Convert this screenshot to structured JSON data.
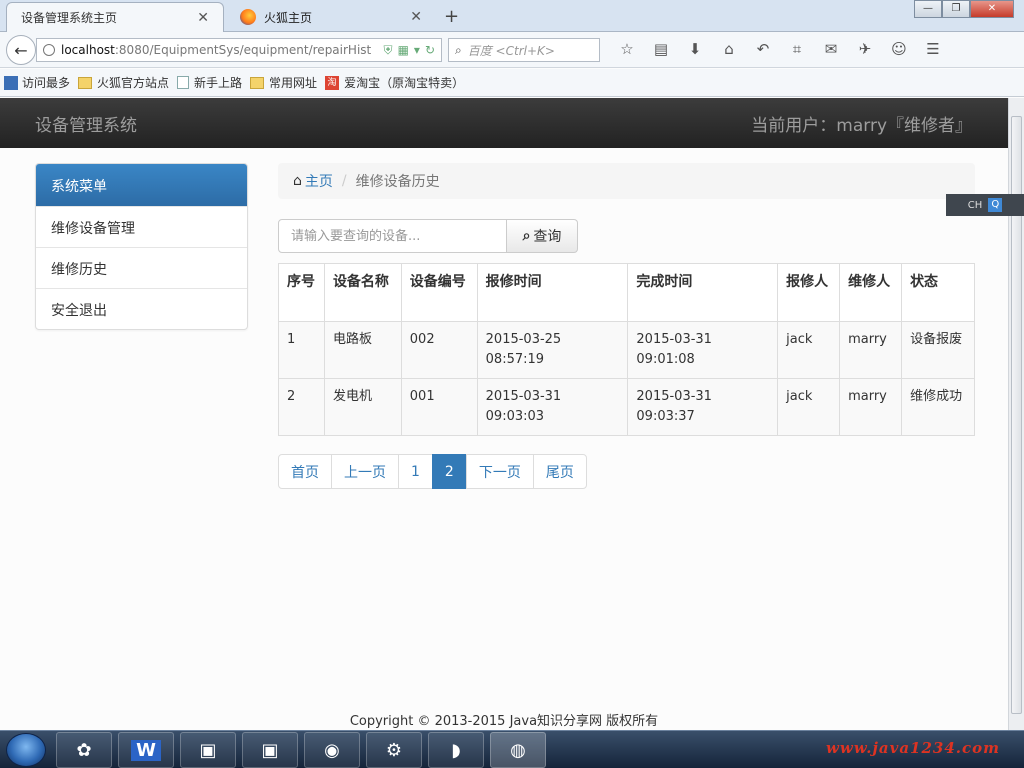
{
  "browser": {
    "tabs": [
      {
        "label": "设备管理系统主页",
        "active": true
      },
      {
        "label": "火狐主页",
        "active": false
      }
    ],
    "url_host": "localhost",
    "url_rest": ":8080/EquipmentSys/equipment/repairHist",
    "search_placeholder": "百度 <Ctrl+K>",
    "bookmarks": [
      "访问最多",
      "火狐官方站点",
      "新手上路",
      "常用网址",
      "爱淘宝（原淘宝特卖）"
    ]
  },
  "header": {
    "brand": "设备管理系统",
    "current_user": "当前用户：marry『维修者』"
  },
  "sidebar": {
    "title": "系统菜单",
    "items": [
      {
        "label": "维修设备管理"
      },
      {
        "label": "维修历史"
      },
      {
        "label": "安全退出"
      }
    ]
  },
  "breadcrumb": {
    "home": "主页",
    "current": "维修设备历史"
  },
  "search": {
    "placeholder": "请输入要查询的设备...",
    "button": "查询"
  },
  "table": {
    "columns": [
      "序号",
      "设备名称",
      "设备编号",
      "报修时间",
      "完成时间",
      "报修人",
      "维修人",
      "状态"
    ],
    "rows": [
      {
        "id": "1",
        "name": "电路板",
        "code": "002",
        "report_time": "2015-03-25 08:57:19",
        "finish_time": "2015-03-31 09:01:08",
        "reporter": "jack",
        "repairer": "marry",
        "status": "设备报废"
      },
      {
        "id": "2",
        "name": "发电机",
        "code": "001",
        "report_time": "2015-03-31 09:03:03",
        "finish_time": "2015-03-31 09:03:37",
        "reporter": "jack",
        "repairer": "marry",
        "status": "维修成功"
      }
    ]
  },
  "pagination": {
    "first": "首页",
    "prev": "上一页",
    "pages": [
      "1",
      "2"
    ],
    "current": "2",
    "next": "下一页",
    "last": "尾页"
  },
  "footer": "Copyright © 2013-2015 Java知识分享网 版权所有",
  "side_badge": "CH",
  "taskbar": {
    "tray_text": "www.java1234.com"
  },
  "colors": {
    "primary": "#337ab7",
    "header_bg": "#222222",
    "sidebar_head": "#2d6ca6"
  }
}
